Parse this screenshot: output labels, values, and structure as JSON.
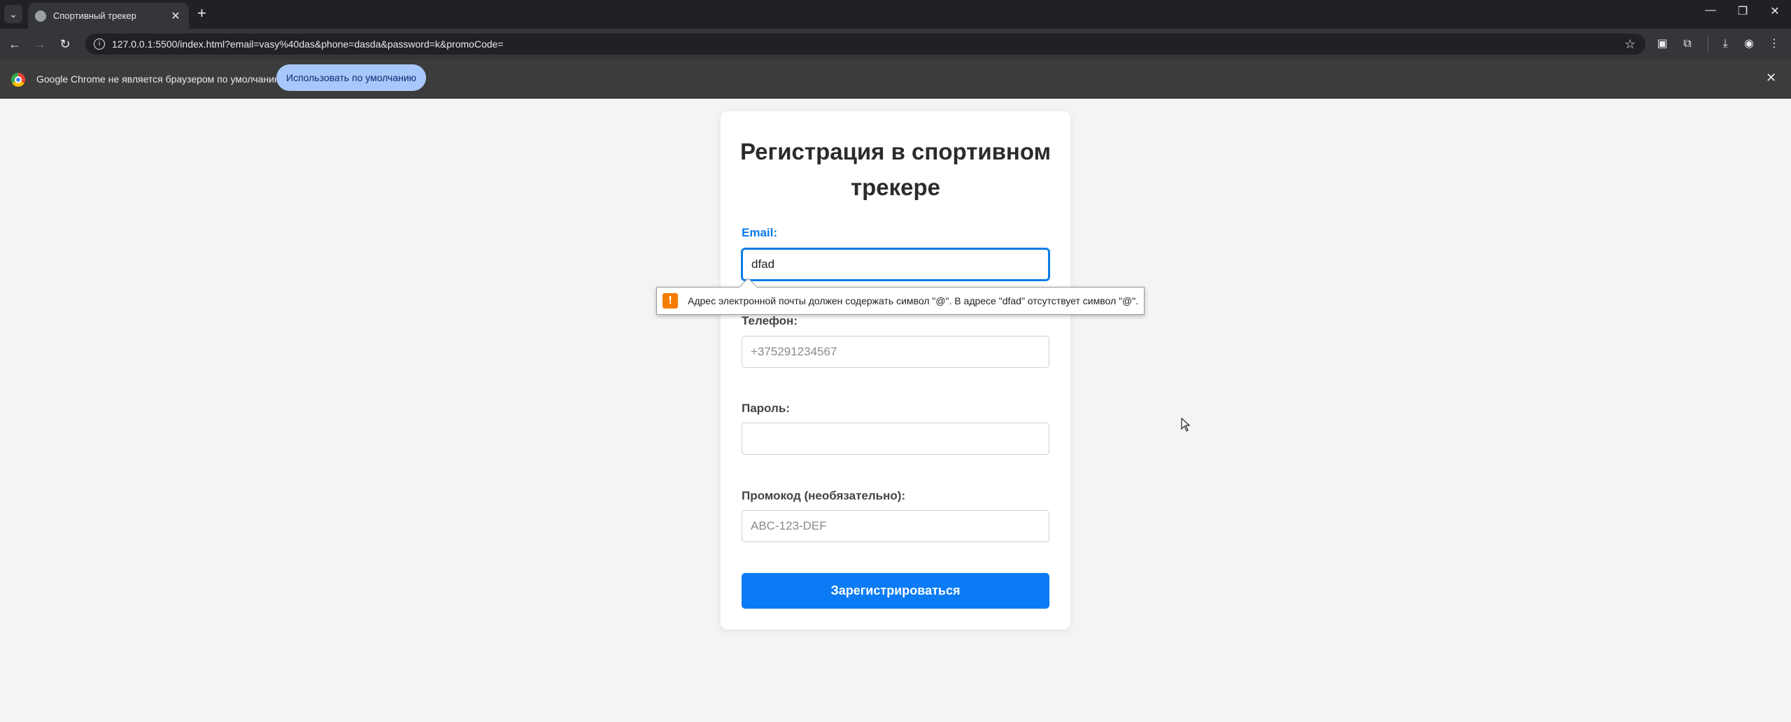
{
  "browser": {
    "tab_title": "Спортивный трекер",
    "url": "127.0.0.1:5500/index.html?email=vasy%40das&phone=dasda&password=k&promoCode=",
    "infobar_text": "Google Chrome не является браузером по умолчанию.",
    "infobar_button": "Использовать по умолчанию"
  },
  "page": {
    "title": "Регистрация в спортивном трекере",
    "email_label": "Email:",
    "email_value": "dfad",
    "phone_label": "Телефон:",
    "phone_placeholder": "+375291234567",
    "password_label": "Пароль:",
    "promo_label": "Промокод (необязательно):",
    "promo_placeholder": "ABC-123-DEF",
    "submit_label": "Зарегистрироваться"
  },
  "validation": {
    "icon": "!",
    "message": "Адрес электронной почты должен содержать символ \"@\". В адресе \"dfad\" отсутствует символ \"@\"."
  },
  "colors": {
    "accent": "#0a7bf5",
    "warning": "#f57c00"
  }
}
